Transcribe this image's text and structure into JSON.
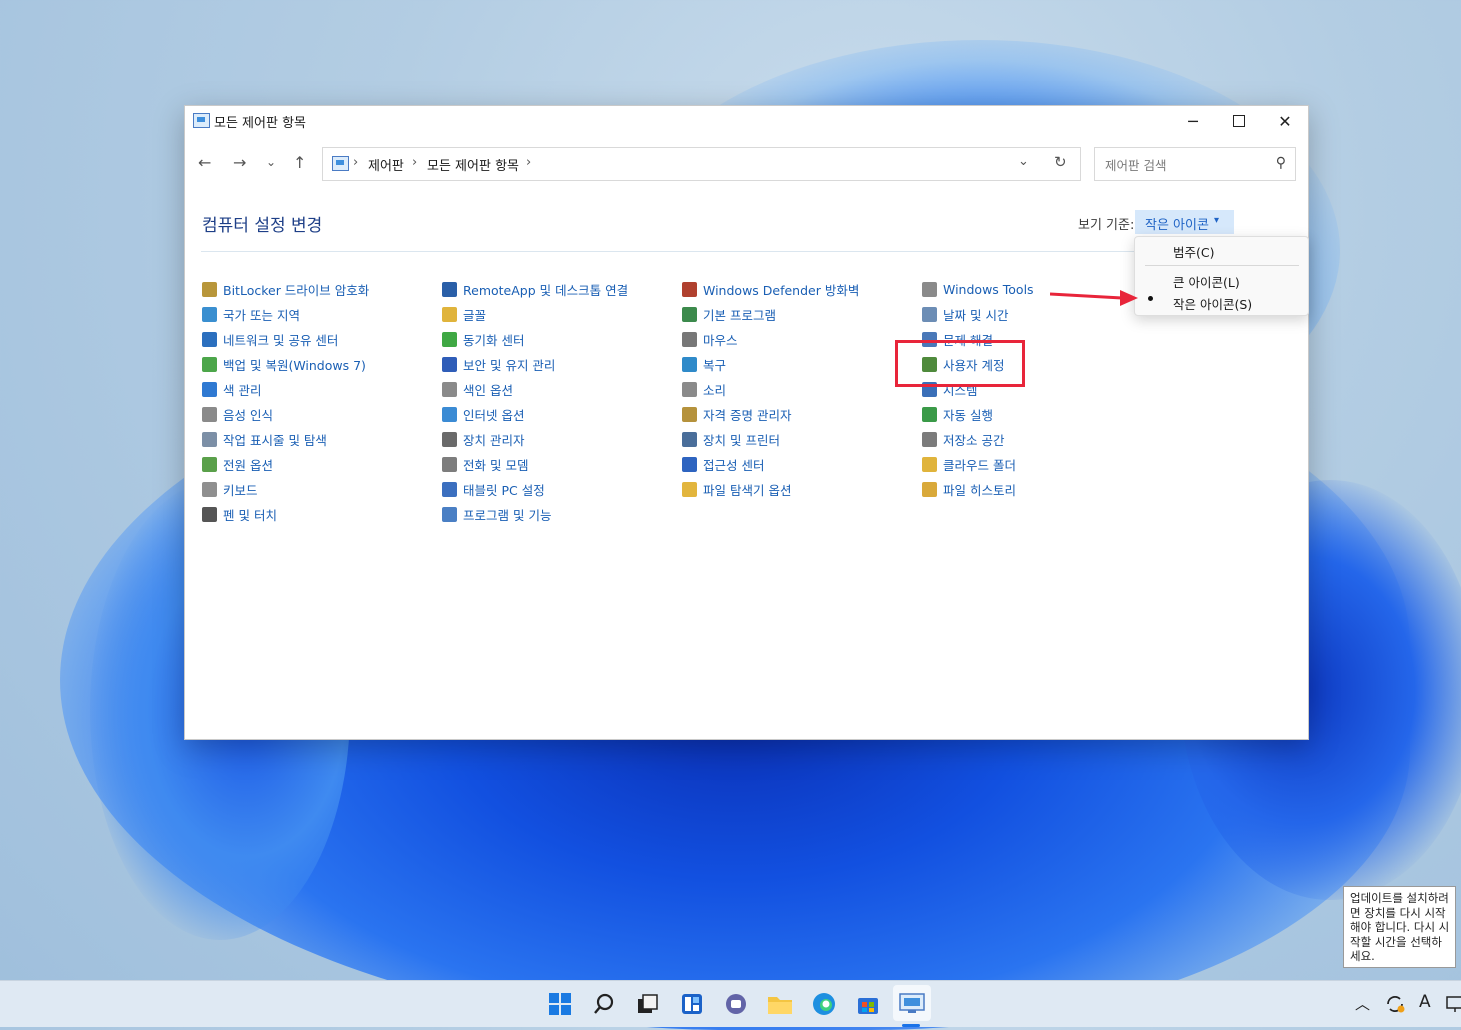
{
  "window": {
    "title": "모든 제어판 항목",
    "min": "─",
    "close": "✕"
  },
  "nav": {
    "back": "←",
    "forward": "→",
    "recent": "⌄",
    "up": "↑",
    "breadcrumbs": [
      "제어판",
      "모든 제어판 항목"
    ],
    "separator": "›",
    "dropdown": "⌄",
    "refresh": "↻",
    "search_placeholder": "제어판 검색",
    "search_icon": "⚲"
  },
  "content": {
    "heading": "컴퓨터 설정 변경",
    "view_by_label": "보기 기준:",
    "view_by_value": "작은 아이콘",
    "view_by_caret": "▾"
  },
  "items": {
    "col1": [
      {
        "label": "BitLocker 드라이브 암호화",
        "icon": "bitlocker-icon",
        "color": "#b8963a"
      },
      {
        "label": "국가 또는 지역",
        "icon": "globe-icon",
        "color": "#3a8fd0"
      },
      {
        "label": "네트워크 및 공유 센터",
        "icon": "network-icon",
        "color": "#2b6fbe"
      },
      {
        "label": "백업 및 복원(Windows 7)",
        "icon": "backup-icon",
        "color": "#4ca64a"
      },
      {
        "label": "색 관리",
        "icon": "color-monitor-icon",
        "color": "#2f79d2"
      },
      {
        "label": "음성 인식",
        "icon": "microphone-icon",
        "color": "#8a8a8a"
      },
      {
        "label": "작업 표시줄 및 탐색",
        "icon": "taskbar-icon",
        "color": "#7c8fa6"
      },
      {
        "label": "전원 옵션",
        "icon": "power-icon",
        "color": "#5aa04a"
      },
      {
        "label": "키보드",
        "icon": "keyboard-icon",
        "color": "#8f8f8f"
      },
      {
        "label": "펜 및 터치",
        "icon": "pen-icon",
        "color": "#555555"
      }
    ],
    "col2": [
      {
        "label": "RemoteApp 및 데스크톱 연결",
        "icon": "remoteapp-icon",
        "color": "#2a5fa8"
      },
      {
        "label": "글꼴",
        "icon": "font-icon",
        "color": "#e0b43c"
      },
      {
        "label": "동기화 센터",
        "icon": "sync-icon",
        "color": "#3fa844"
      },
      {
        "label": "보안 및 유지 관리",
        "icon": "flag-icon",
        "color": "#2f5db8"
      },
      {
        "label": "색인 옵션",
        "icon": "indexing-icon",
        "color": "#8a8a8a"
      },
      {
        "label": "인터넷 옵션",
        "icon": "internet-icon",
        "color": "#3b8bd4"
      },
      {
        "label": "장치 관리자",
        "icon": "device-manager-icon",
        "color": "#6a6a6a"
      },
      {
        "label": "전화 및 모뎀",
        "icon": "phone-icon",
        "color": "#7d7d7d"
      },
      {
        "label": "태블릿 PC 설정",
        "icon": "tablet-icon",
        "color": "#3b6fbf"
      },
      {
        "label": "프로그램 및 기능",
        "icon": "programs-icon",
        "color": "#4a7fc4"
      }
    ],
    "col3": [
      {
        "label": "Windows Defender 방화벽",
        "icon": "firewall-icon",
        "color": "#b0402e"
      },
      {
        "label": "기본 프로그램",
        "icon": "default-programs-icon",
        "color": "#3c8a4c"
      },
      {
        "label": "마우스",
        "icon": "mouse-icon",
        "color": "#777777"
      },
      {
        "label": "복구",
        "icon": "recovery-icon",
        "color": "#2f8ac9"
      },
      {
        "label": "소리",
        "icon": "speaker-icon",
        "color": "#8a8a8a"
      },
      {
        "label": "자격 증명 관리자",
        "icon": "credential-icon",
        "color": "#b5923c"
      },
      {
        "label": "장치 및 프린터",
        "icon": "printer-icon",
        "color": "#4a6e9a"
      },
      {
        "label": "접근성 센터",
        "icon": "accessibility-icon",
        "color": "#2e64c0"
      },
      {
        "label": "파일 탐색기 옵션",
        "icon": "folder-options-icon",
        "color": "#e2b53d"
      }
    ],
    "col4": [
      {
        "label": "Windows Tools",
        "icon": "tools-icon",
        "color": "#8a8a8a"
      },
      {
        "label": "날짜 및 시간",
        "icon": "clock-icon",
        "color": "#6c8db5"
      },
      {
        "label": "문제 해결",
        "icon": "troubleshoot-icon",
        "color": "#4a78b8"
      },
      {
        "label": "사용자 계정",
        "icon": "user-accounts-icon",
        "color": "#4f8a3c"
      },
      {
        "label": "시스템",
        "icon": "system-icon",
        "color": "#3a6fb8"
      },
      {
        "label": "자동 실행",
        "icon": "autoplay-icon",
        "color": "#3a9a48"
      },
      {
        "label": "저장소 공간",
        "icon": "storage-icon",
        "color": "#7b7b7b"
      },
      {
        "label": "클라우드 폴더",
        "icon": "cloud-folder-icon",
        "color": "#e0b43c"
      },
      {
        "label": "파일 히스토리",
        "icon": "file-history-icon",
        "color": "#d9a93a"
      }
    ]
  },
  "menu": {
    "category": "범주(C)",
    "large": "큰 아이콘(L)",
    "small": "작은 아이콘(S)"
  },
  "tooltip": {
    "text": "업데이트를 설치하려면 장치를 다시 시작해야 합니다. 다시 시작할 시간을 선택하세요."
  },
  "taskbar": {
    "tray_chevron": "︿",
    "tray_input": "A"
  },
  "colors": {
    "accent": "#1a5fb4",
    "highlight": "#e8253a"
  }
}
